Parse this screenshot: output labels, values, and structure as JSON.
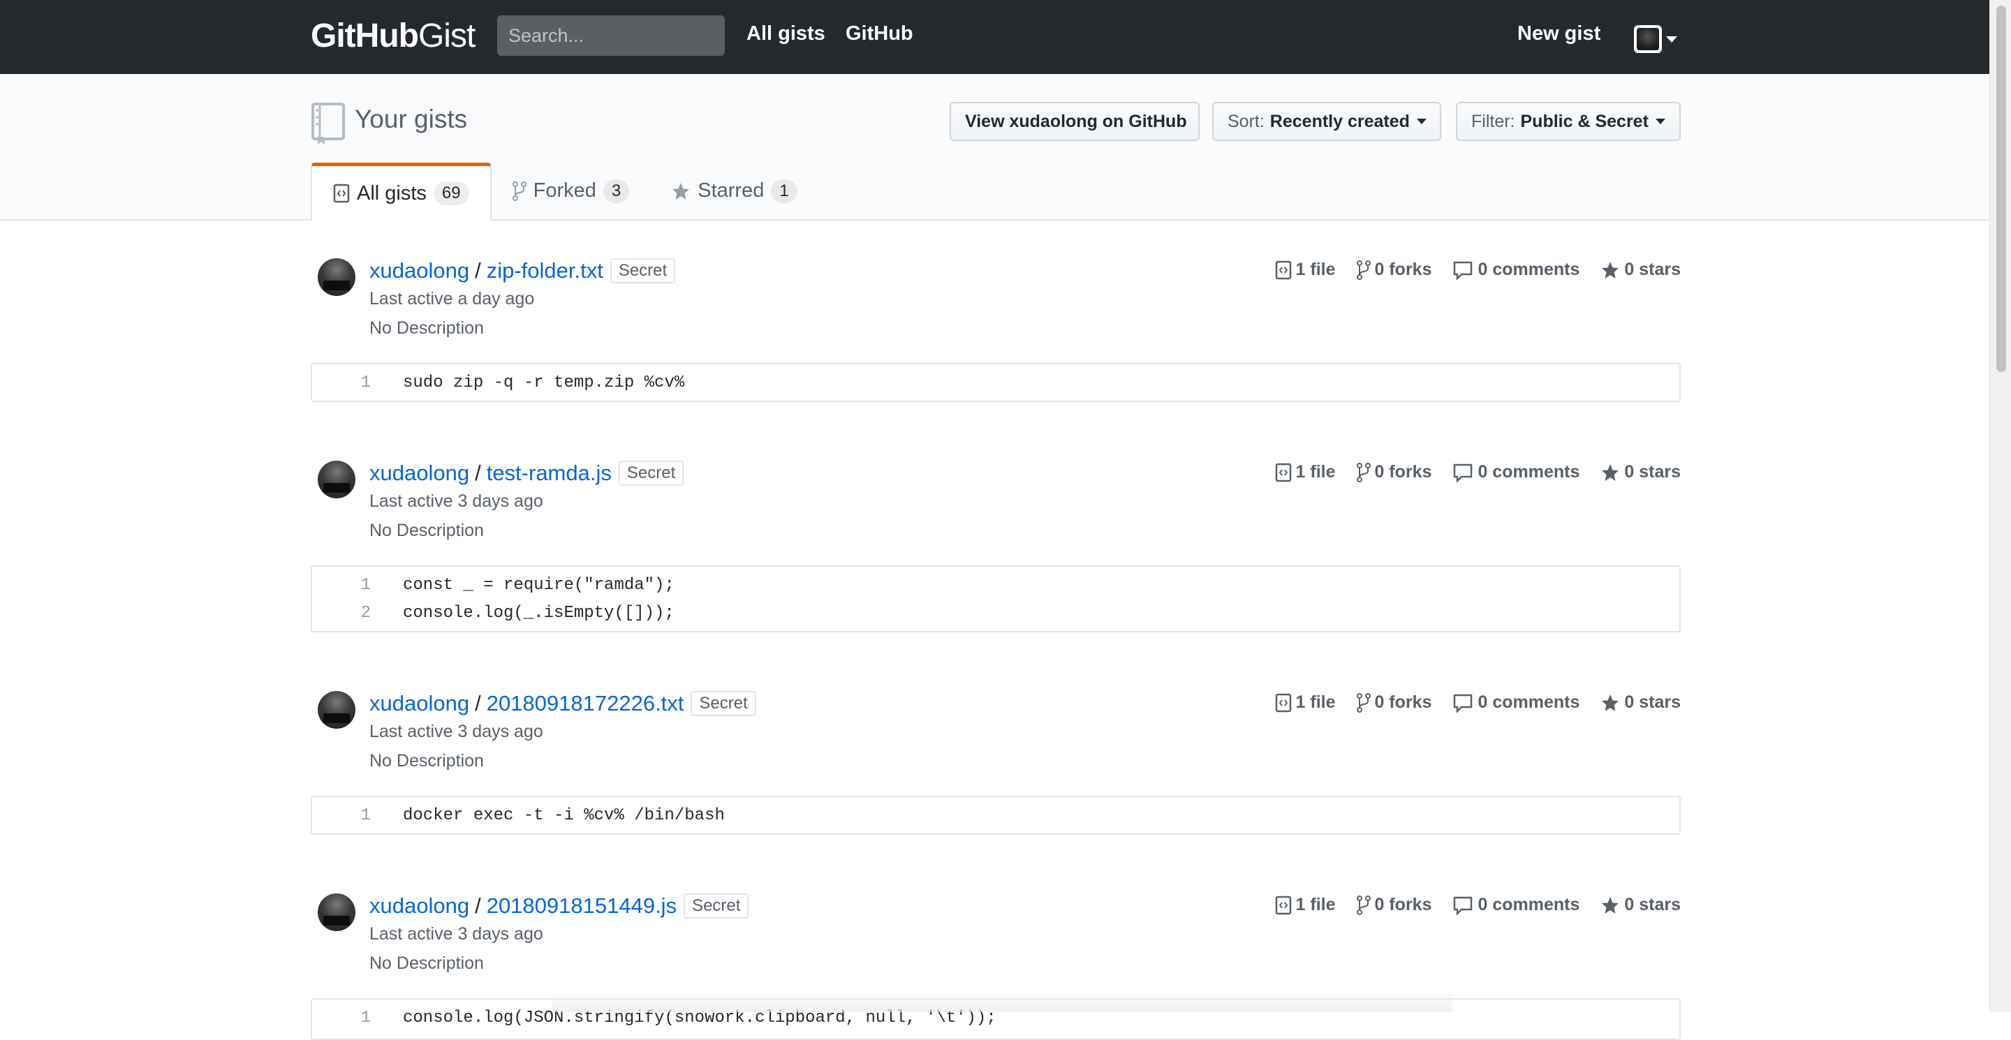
{
  "header": {
    "logo_bold": "GitHub",
    "logo_light": "Gist",
    "search_placeholder": "Search...",
    "nav_all_gists": "All gists",
    "nav_github": "GitHub",
    "new_gist": "New gist"
  },
  "subhead": {
    "title": "Your gists",
    "view_button": "View xudaolong on GitHub",
    "sort_prefix": "Sort:",
    "sort_value": "Recently created",
    "filter_prefix": "Filter:",
    "filter_value": "Public & Secret",
    "tabs": [
      {
        "label": "All gists",
        "count": "69",
        "icon": "code-icon",
        "selected": true
      },
      {
        "label": "Forked",
        "count": "3",
        "icon": "fork-icon"
      },
      {
        "label": "Starred",
        "count": "1",
        "icon": "star-icon"
      }
    ]
  },
  "gists": [
    {
      "owner": "xudaolong",
      "filename": "zip-folder.txt",
      "visibility": "Secret",
      "last_active": "Last active a day ago",
      "description": "No Description",
      "files": "1 file",
      "forks": "0 forks",
      "comments": "0 comments",
      "stars": "0 stars",
      "lines": [
        {
          "n": "1",
          "code": "sudo zip -q -r temp.zip %cv%"
        }
      ]
    },
    {
      "owner": "xudaolong",
      "filename": "test-ramda.js",
      "visibility": "Secret",
      "last_active": "Last active 3 days ago",
      "description": "No Description",
      "files": "1 file",
      "forks": "0 forks",
      "comments": "0 comments",
      "stars": "0 stars",
      "lines": [
        {
          "n": "1",
          "code": "const _ = require(\"ramda\");"
        },
        {
          "n": "2",
          "code": "console.log(_.isEmpty([]));"
        }
      ]
    },
    {
      "owner": "xudaolong",
      "filename": "20180918172226.txt",
      "visibility": "Secret",
      "last_active": "Last active 3 days ago",
      "description": "No Description",
      "files": "1 file",
      "forks": "0 forks",
      "comments": "0 comments",
      "stars": "0 stars",
      "lines": [
        {
          "n": "1",
          "code": "docker exec -t -i %cv% /bin/bash"
        }
      ]
    },
    {
      "owner": "xudaolong",
      "filename": "20180918151449.js",
      "visibility": "Secret",
      "last_active": "Last active 3 days ago",
      "description": "No Description",
      "files": "1 file",
      "forks": "0 forks",
      "comments": "0 comments",
      "stars": "0 stars",
      "lines": [
        {
          "n": "1",
          "code": "console.log(JSON.stringify(snowork.clipboard, null, '\\t'));"
        }
      ]
    }
  ]
}
